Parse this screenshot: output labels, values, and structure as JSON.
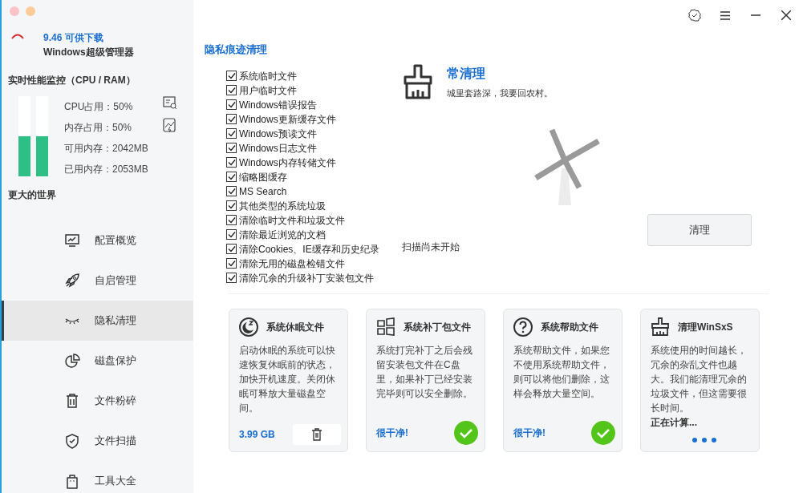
{
  "app": {
    "version_notice": "9.46 可供下载",
    "name": "Windows超级管理器"
  },
  "monitor": {
    "title": "实时性能监控（CPU / RAM）",
    "bars": [
      {
        "level": 0.5
      },
      {
        "level": 0.5
      }
    ],
    "stats": [
      "CPU占用：50%",
      "内存占用：50%",
      "可用内存：2042MB",
      "已用内存：2053MB"
    ],
    "footer": "更大的世界"
  },
  "sidebar": {
    "items": [
      {
        "label": "配置概览",
        "selected": false
      },
      {
        "label": "自启管理",
        "selected": false
      },
      {
        "label": "隐私清理",
        "selected": true
      },
      {
        "label": "磁盘保护",
        "selected": false
      },
      {
        "label": "文件粉碎",
        "selected": false
      },
      {
        "label": "文件扫描",
        "selected": false
      },
      {
        "label": "工具大全",
        "selected": false
      }
    ]
  },
  "page_title": "隐私痕迹清理",
  "checklist": [
    {
      "label": "系统临时文件",
      "checked": true
    },
    {
      "label": "用户临时文件",
      "checked": true
    },
    {
      "label": "Windows错误报告",
      "checked": true
    },
    {
      "label": "Windows更新缓存文件",
      "checked": true
    },
    {
      "label": "Windows预读文件",
      "checked": true
    },
    {
      "label": "Windows日志文件",
      "checked": true
    },
    {
      "label": "Windows内存转储文件",
      "checked": true
    },
    {
      "label": "缩略图缓存",
      "checked": true
    },
    {
      "label": "MS Search",
      "checked": true
    },
    {
      "label": "其他类型的系统垃圾",
      "checked": true
    },
    {
      "label": "清除临时文件和垃圾文件",
      "checked": true
    },
    {
      "label": "清除最近浏览的文档",
      "checked": true
    },
    {
      "label": "清除Cookies、IE缓存和历史纪录",
      "checked": true
    },
    {
      "label": "清除无用的磁盘检错文件",
      "checked": true
    },
    {
      "label": "清除冗余的升级补丁安装包文件",
      "checked": true
    }
  ],
  "hero": {
    "title": "常清理",
    "subtitle": "城里套路深，我要回农村。"
  },
  "scan_status": "扫描尚未开始",
  "clean_button": "清理",
  "cards": [
    {
      "title": "系统休眠文件",
      "text": "启动休眠的系统可以快速恢复休眠前的状态，加快开机速度。关闭休眠可释放大量磁盘空间。",
      "kind": "delete",
      "status": "3.99 GB"
    },
    {
      "title": "系统补丁包文件",
      "text": "系统打完补丁之后会残留安装包文件在C盘里，如果补丁已经安装完毕则可以安全删除。",
      "kind": "clean",
      "status": "很干净!"
    },
    {
      "title": "系统帮助文件",
      "text": "系统帮助文件，如果您不使用系统帮助文件，则可以将他们删除，这样会释放大量空间。",
      "kind": "clean",
      "status": "很干净!"
    },
    {
      "title": "清理WinSxS",
      "text": "系统使用的时间越长，冗余的杂乱文件也越大。我们能清理冗余的垃圾文件，但这需要很长时间。",
      "kind": "calculating",
      "status": "正在计算..."
    }
  ]
}
